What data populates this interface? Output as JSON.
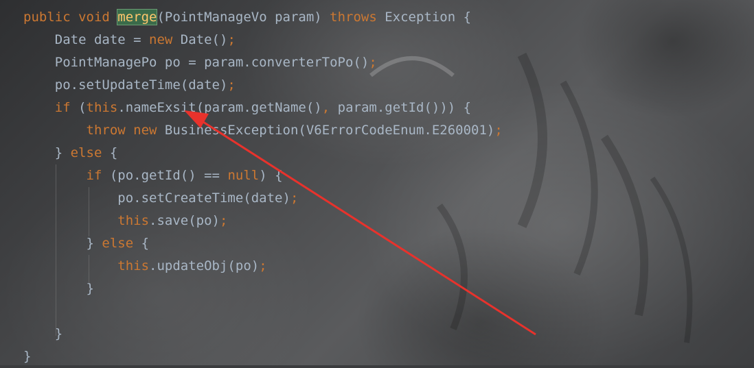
{
  "code_lines": [
    {
      "tokens": [
        {
          "t": "public ",
          "c": "kw"
        },
        {
          "t": "void ",
          "c": "kw"
        },
        {
          "t": "merge",
          "c": "hl"
        },
        {
          "t": "(PointManageVo param) ",
          "c": ""
        },
        {
          "t": "throws ",
          "c": "kw"
        },
        {
          "t": "Exception {",
          "c": ""
        }
      ]
    },
    {
      "tokens": [
        {
          "t": "    Date date = ",
          "c": ""
        },
        {
          "t": "new ",
          "c": "kw"
        },
        {
          "t": "Date()",
          "c": ""
        },
        {
          "t": ";",
          "c": "kw"
        }
      ]
    },
    {
      "tokens": [
        {
          "t": "    PointManagePo po = param.converterToPo()",
          "c": ""
        },
        {
          "t": ";",
          "c": "kw"
        }
      ]
    },
    {
      "tokens": [
        {
          "t": "    po.setUpdateTime(date)",
          "c": ""
        },
        {
          "t": ";",
          "c": "kw"
        }
      ]
    },
    {
      "tokens": [
        {
          "t": "    ",
          "c": ""
        },
        {
          "t": "if ",
          "c": "kw"
        },
        {
          "t": "(",
          "c": ""
        },
        {
          "t": "this",
          "c": "kw"
        },
        {
          "t": ".nameExsit(param.getName()",
          "c": ""
        },
        {
          "t": ", ",
          "c": "kw"
        },
        {
          "t": "param.getId())) {",
          "c": ""
        }
      ]
    },
    {
      "tokens": [
        {
          "t": "        ",
          "c": ""
        },
        {
          "t": "throw ",
          "c": "kw"
        },
        {
          "t": "new ",
          "c": "kw"
        },
        {
          "t": "BusinessException(V6ErrorCodeEnum.E260001)",
          "c": ""
        },
        {
          "t": ";",
          "c": "kw"
        }
      ]
    },
    {
      "tokens": [
        {
          "t": "    } ",
          "c": ""
        },
        {
          "t": "else ",
          "c": "kw"
        },
        {
          "t": "{",
          "c": ""
        }
      ]
    },
    {
      "tokens": [
        {
          "t": "        ",
          "c": ""
        },
        {
          "t": "if ",
          "c": "kw"
        },
        {
          "t": "(po.getId() == ",
          "c": ""
        },
        {
          "t": "null",
          "c": "kw"
        },
        {
          "t": ") {",
          "c": ""
        }
      ]
    },
    {
      "tokens": [
        {
          "t": "            po.setCreateTime(date)",
          "c": ""
        },
        {
          "t": ";",
          "c": "kw"
        }
      ]
    },
    {
      "tokens": [
        {
          "t": "            ",
          "c": ""
        },
        {
          "t": "this",
          "c": "kw"
        },
        {
          "t": ".save(po)",
          "c": ""
        },
        {
          "t": ";",
          "c": "kw"
        }
      ]
    },
    {
      "tokens": [
        {
          "t": "        } ",
          "c": ""
        },
        {
          "t": "else ",
          "c": "kw"
        },
        {
          "t": "{",
          "c": ""
        }
      ]
    },
    {
      "tokens": [
        {
          "t": "            ",
          "c": ""
        },
        {
          "t": "this",
          "c": "kw"
        },
        {
          "t": ".updateObj(po)",
          "c": ""
        },
        {
          "t": ";",
          "c": "kw"
        }
      ]
    },
    {
      "tokens": [
        {
          "t": "        }",
          "c": ""
        }
      ]
    },
    {
      "tokens": [
        {
          "t": "",
          "c": ""
        }
      ]
    },
    {
      "tokens": [
        {
          "t": "    }",
          "c": ""
        }
      ]
    },
    {
      "tokens": [
        {
          "t": "}",
          "c": ""
        }
      ]
    }
  ],
  "colors": {
    "keyword": "#cc7832",
    "identifier": "#a9b7c6",
    "method_highlight": "#ffc66d",
    "highlight_bg": "#3b6b4a",
    "annotation_arrow": "#e8322c"
  }
}
